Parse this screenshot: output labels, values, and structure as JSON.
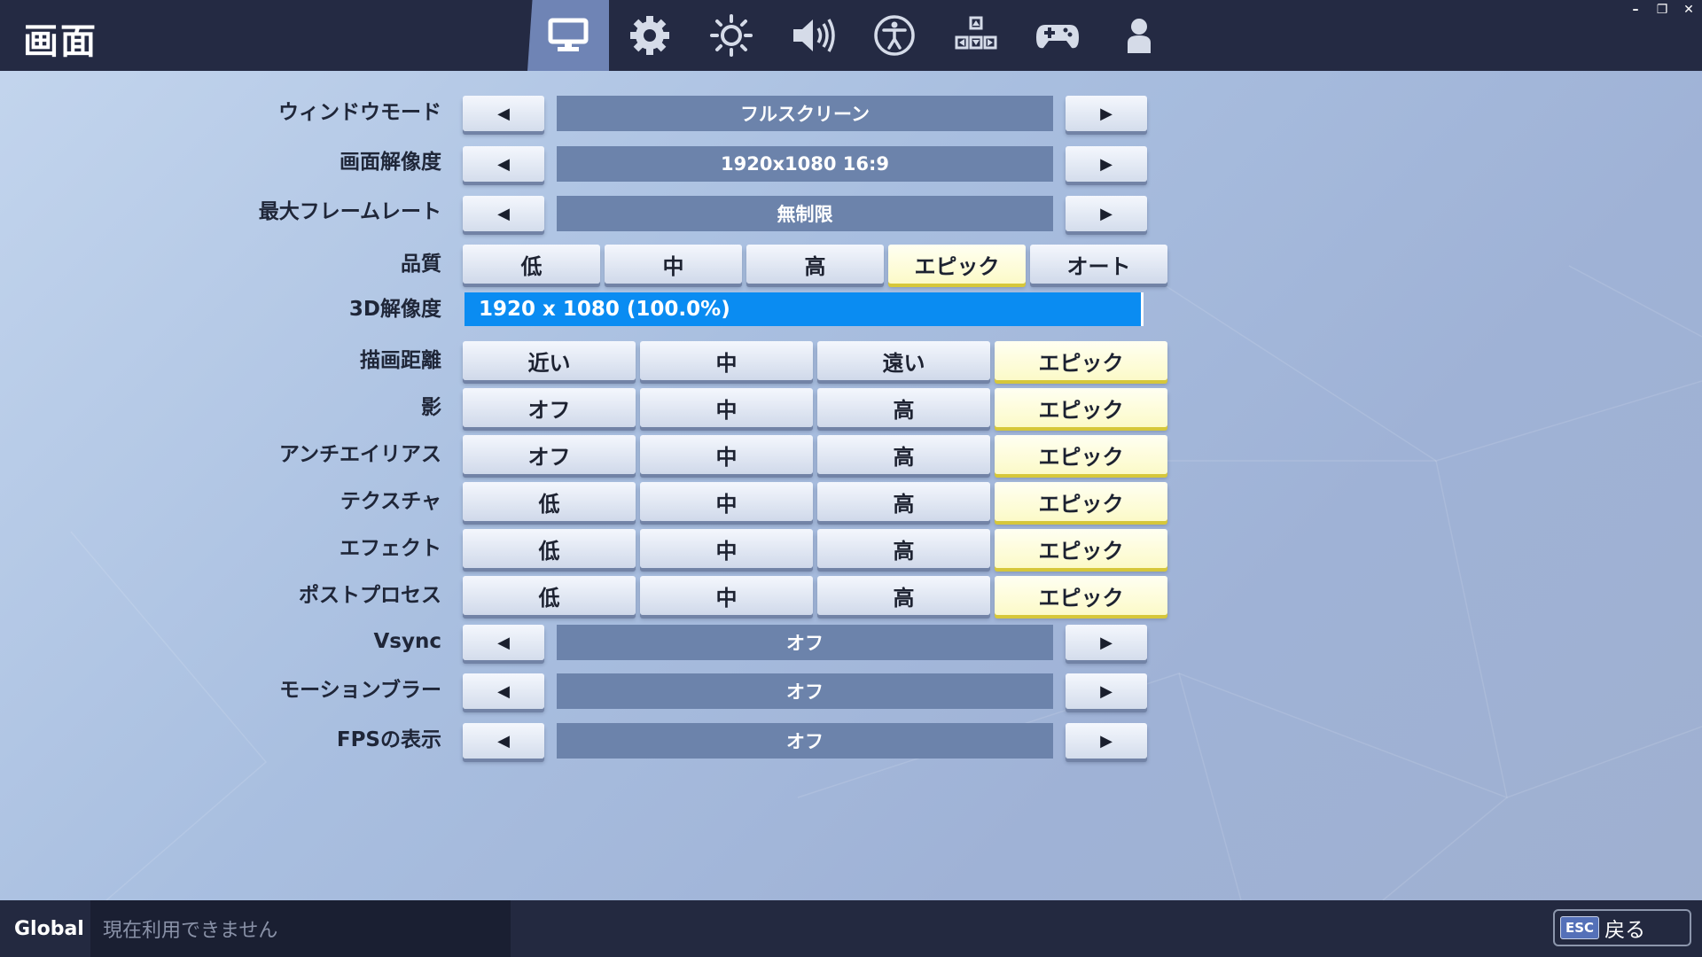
{
  "header": {
    "title": "画面",
    "tabs": [
      {
        "icon": "monitor-icon",
        "active": true
      },
      {
        "icon": "gear-icon",
        "active": false
      },
      {
        "icon": "brightness-icon",
        "active": false
      },
      {
        "icon": "speaker-icon",
        "active": false
      },
      {
        "icon": "accessibility-icon",
        "active": false
      },
      {
        "icon": "input-keys-icon",
        "active": false
      },
      {
        "icon": "gamepad-icon",
        "active": false
      },
      {
        "icon": "user-icon",
        "active": false
      }
    ],
    "window_controls": {
      "minimize": "–",
      "restore": "❐",
      "close": "✕"
    }
  },
  "settings": {
    "window_mode": {
      "label": "ウィンドウモード",
      "value": "フルスクリーン"
    },
    "resolution": {
      "label": "画面解像度",
      "value": "1920x1080 16:9"
    },
    "frame_rate": {
      "label": "最大フレームレート",
      "value": "無制限"
    },
    "quality": {
      "label": "品質",
      "options": [
        "低",
        "中",
        "高",
        "エピック",
        "オート"
      ],
      "selected": "エピック"
    },
    "resolution_3d": {
      "label": "3D解像度",
      "value": "1920 x 1080 (100.0%)",
      "percent": 100
    },
    "view_distance": {
      "label": "描画距離",
      "options": [
        "近い",
        "中",
        "遠い",
        "エピック"
      ],
      "selected": "エピック"
    },
    "shadows": {
      "label": "影",
      "options": [
        "オフ",
        "中",
        "高",
        "エピック"
      ],
      "selected": "エピック"
    },
    "anti_aliasing": {
      "label": "アンチエイリアス",
      "options": [
        "オフ",
        "中",
        "高",
        "エピック"
      ],
      "selected": "エピック"
    },
    "textures": {
      "label": "テクスチャ",
      "options": [
        "低",
        "中",
        "高",
        "エピック"
      ],
      "selected": "エピック"
    },
    "effects": {
      "label": "エフェクト",
      "options": [
        "低",
        "中",
        "高",
        "エピック"
      ],
      "selected": "エピック"
    },
    "post_process": {
      "label": "ポストプロセス",
      "options": [
        "低",
        "中",
        "高",
        "エピック"
      ],
      "selected": "エピック"
    },
    "vsync": {
      "label": "Vsync",
      "value": "オフ"
    },
    "motion_blur": {
      "label": "モーションブラー",
      "value": "オフ"
    },
    "show_fps": {
      "label": "FPSの表示",
      "value": "オフ"
    }
  },
  "arrows": {
    "left": "◀",
    "right": "▶"
  },
  "footer": {
    "global_label": "Global",
    "status_text": "現在利用できません",
    "back_key": "ESC",
    "back_label": "戻る"
  },
  "colors": {
    "accent_blue": "#0a8cf2",
    "selected_option": "#fcfac8",
    "bar_background": "#242a43",
    "value_box": "#6c83ab"
  }
}
